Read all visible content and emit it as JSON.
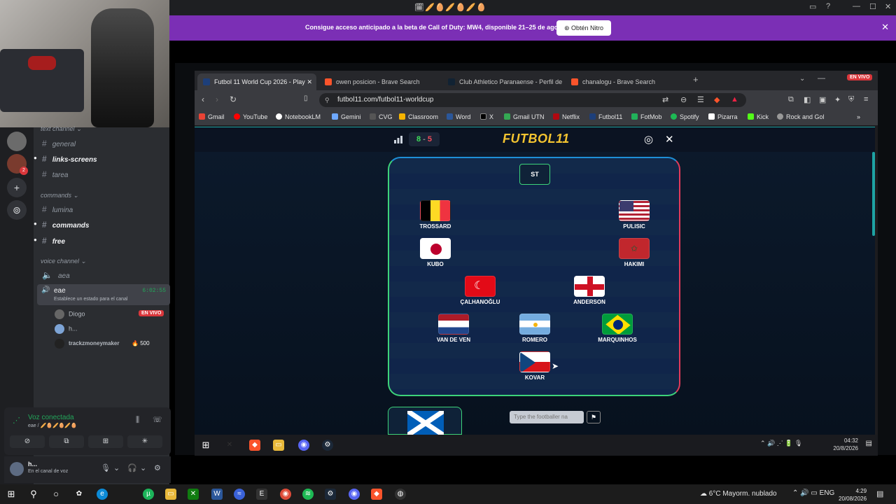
{
  "discord": {
    "titlebar_emojis": "🗓🥖🥚🥖🥚🥖🥚",
    "nitro_message": "Consigue acceso anticipado a la beta de Call of Duty: MW4, disponible 21–25 de agosto.",
    "nitro_button": "Obtén Nitro",
    "categories": {
      "text": "text channel",
      "commands": "commands",
      "voice": "voice channel"
    },
    "text_channels": [
      "general",
      "links-screens",
      "tarea"
    ],
    "command_channels": [
      "lumina",
      "commands",
      "free"
    ],
    "voice_channels": [
      "aea",
      "eae"
    ],
    "active_call": {
      "name": "eae",
      "time": "6:02:55",
      "status": "Establece un estado para el canal"
    },
    "voice_users": [
      {
        "name": "Diogo",
        "badge": "EN VIVO"
      },
      {
        "name": "h..."
      },
      {
        "name": "trackzmoneymaker",
        "badge": "500"
      }
    ],
    "voice_panel": {
      "title": "Voz conectada",
      "subtitle": "eae / 🥖🥚🥖🥚🥖🥚"
    },
    "user": {
      "name": "h...",
      "status": "En el canal de voz"
    },
    "server_badge": "2"
  },
  "browser": {
    "tabs": [
      {
        "title": "Futbol 11 World Cup 2026 - Play"
      },
      {
        "title": "owen posicion - Brave Search"
      },
      {
        "title": "Club Athletico Paranaense - Perfil de"
      },
      {
        "title": "chanalogu - Brave Search"
      }
    ],
    "url": "futbol11.com/futbol11-worldcup",
    "live_badge": "EN VIVO",
    "bookmarks": [
      "Gmail",
      "YouTube",
      "NotebookLM",
      "Gemini",
      "CVG",
      "Classroom",
      "Word",
      "X",
      "Gmail UTN",
      "Netflix",
      "Futbol11",
      "FotMob",
      "Spotify",
      "Pizarra",
      "Kick",
      "Rock and Gol"
    ]
  },
  "game": {
    "score_correct": "8",
    "score_sep": "-",
    "score_wrong": "5",
    "logo": "FUTBOL11",
    "slot_empty": "ST",
    "players": {
      "trossard": "TROSSARD",
      "pulisic": "PULISIC",
      "kubo": "KUBO",
      "hakimi": "HAKIMI",
      "calhanoglu": "ÇALHANOĞLU",
      "anderson": "ANDERSON",
      "vandeven": "VAN DE VEN",
      "romero": "ROMERO",
      "marquinhos": "MARQUINHOS",
      "kovar": "KOVAR"
    },
    "input_placeholder": "Type the footballer na",
    "colors": {
      "accent": "#f4c430",
      "correct": "#3ddc5a",
      "wrong": "#ef4b5a"
    }
  },
  "inner_clock": {
    "time": "04:32",
    "date": "20/8/2026"
  },
  "taskbar": {
    "weather": "6°C  Mayorm. nublado",
    "lang": "ENG",
    "time": "4:29",
    "date": "20/08/2026"
  }
}
